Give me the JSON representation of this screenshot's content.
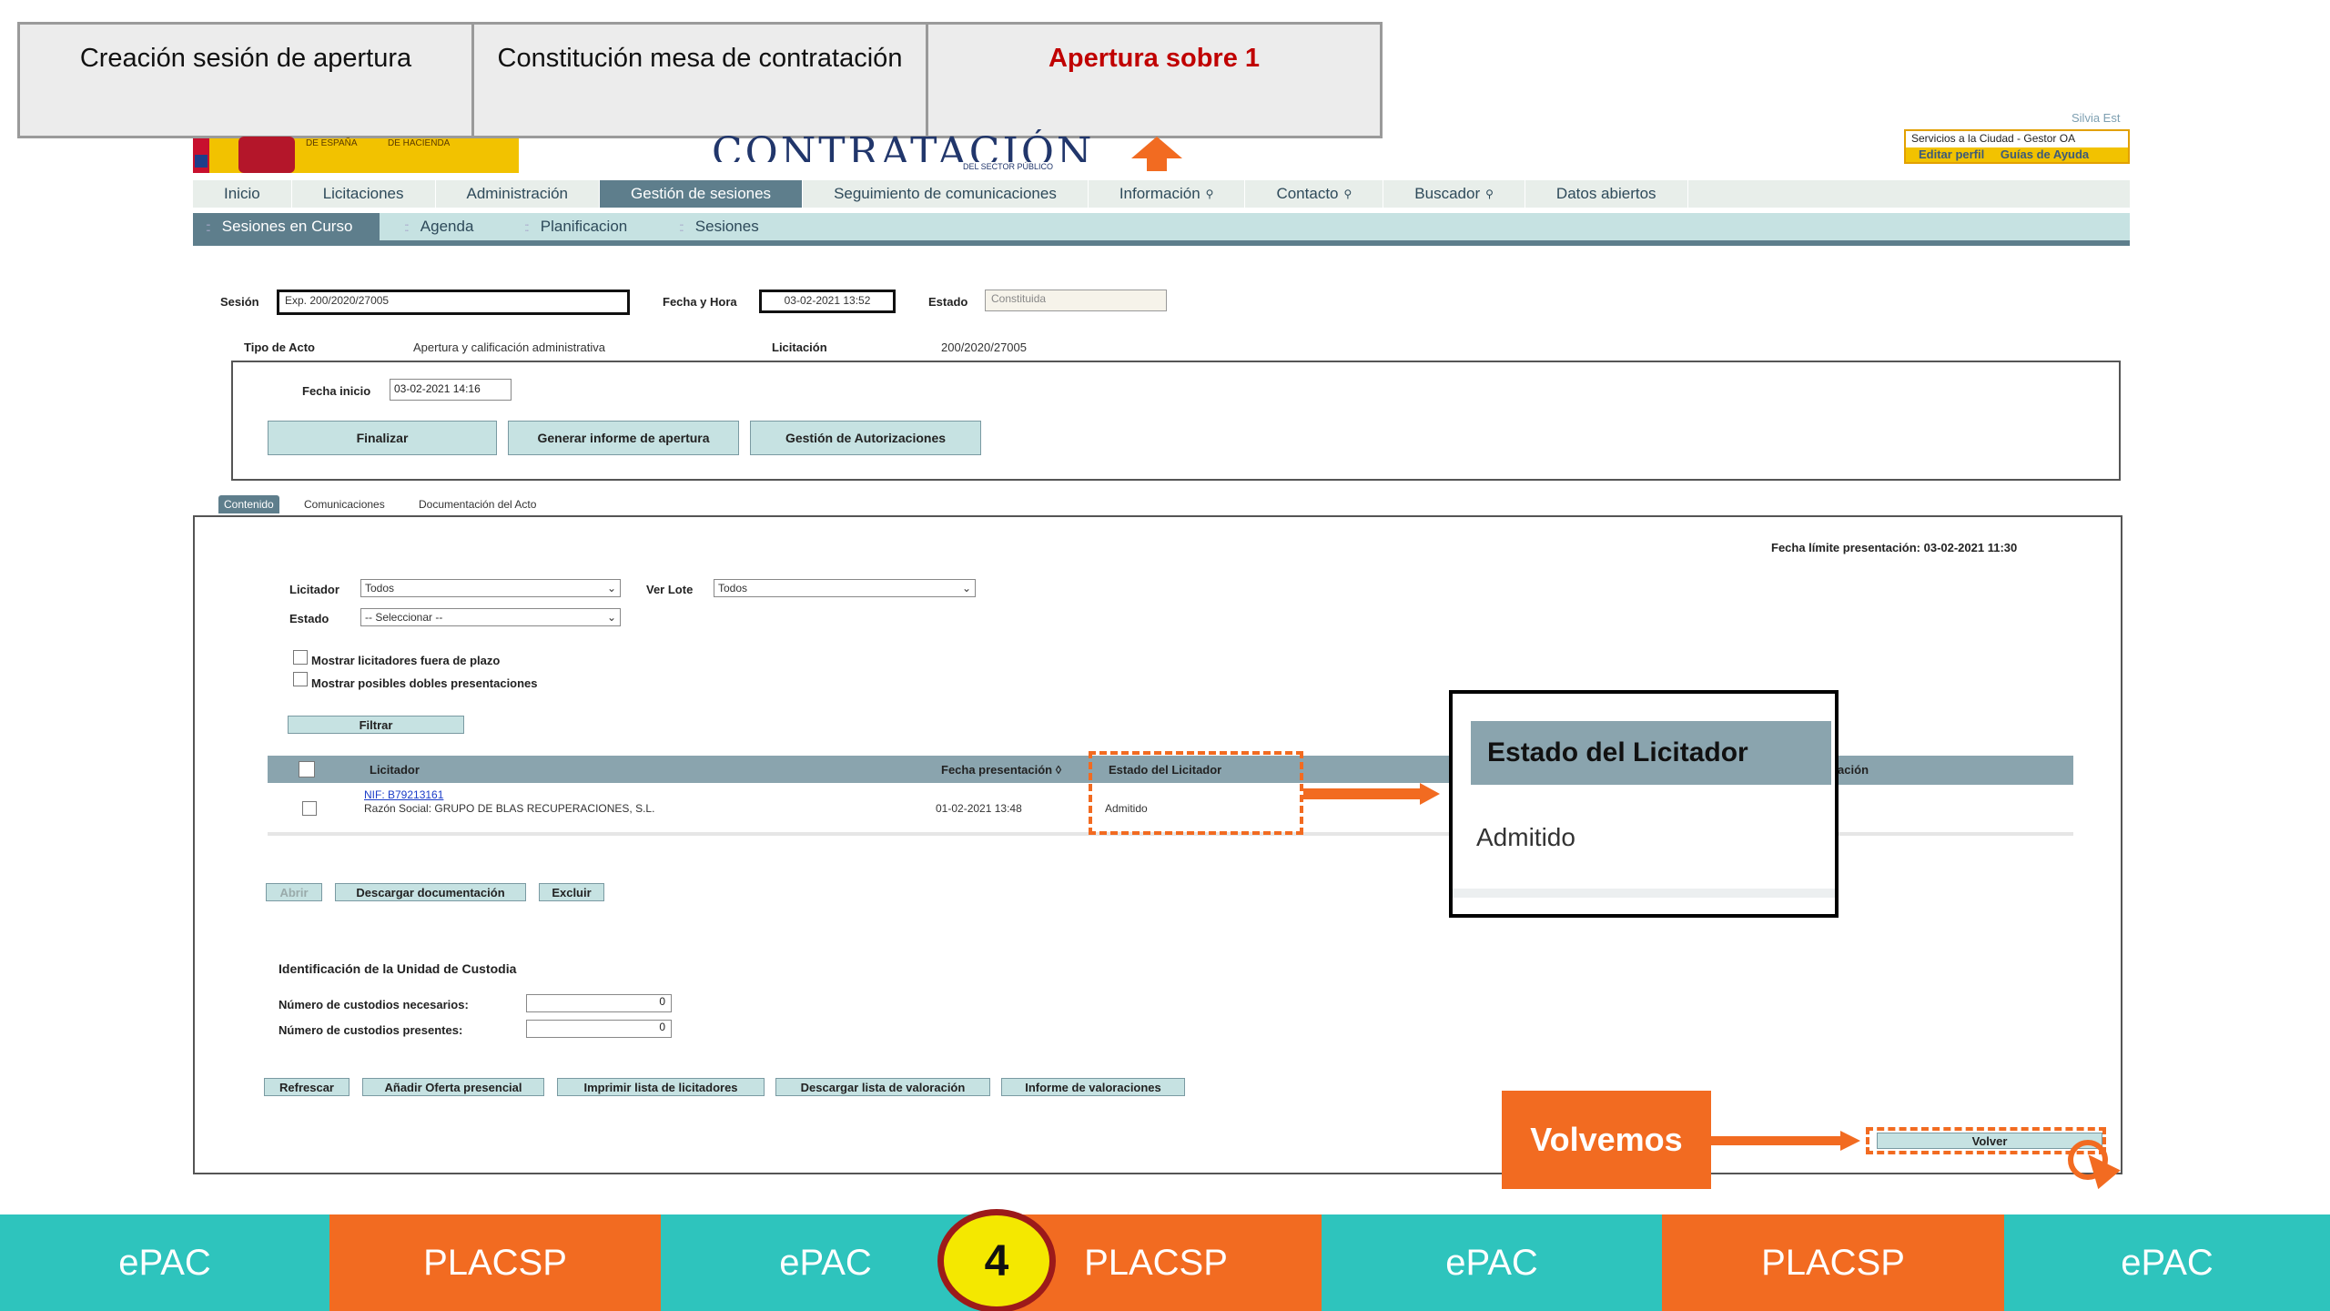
{
  "steps": [
    {
      "label": "Creación sesión de apertura"
    },
    {
      "label": "Constitución mesa de contratación"
    },
    {
      "label": "Apertura sobre 1"
    }
  ],
  "header": {
    "ministry_left": "DE ESPAÑA",
    "ministry_right": "DE HACIENDA",
    "logo": "CONTRATACIÓN",
    "logo_sub": "DEL SECTOR PÚBLICO",
    "user_name": "Silvia Est",
    "user_role": "Servicios a la Ciudad - Gestor OA",
    "edit_profile": "Editar perfil",
    "help": "Guías de Ayuda"
  },
  "nav": [
    {
      "label": "Inicio"
    },
    {
      "label": "Licitaciones"
    },
    {
      "label": "Administración"
    },
    {
      "label": "Gestión de sesiones"
    },
    {
      "label": "Seguimiento de comunicaciones"
    },
    {
      "label": "Información"
    },
    {
      "label": "Contacto"
    },
    {
      "label": "Buscador"
    },
    {
      "label": "Datos abiertos"
    }
  ],
  "subnav": [
    {
      "label": "Sesiones en Curso"
    },
    {
      "label": "Agenda"
    },
    {
      "label": "Planificacion"
    },
    {
      "label": "Sesiones"
    }
  ],
  "session": {
    "sesion_label": "Sesión",
    "sesion_value": "Exp. 200/2020/27005",
    "fecha_label": "Fecha y Hora",
    "fecha_value": "03-02-2021 13:52",
    "estado_label": "Estado",
    "estado_value": "Constituida",
    "tipo_label": "Tipo de Acto",
    "tipo_value": "Apertura y calificación administrativa",
    "licitacion_label": "Licitación",
    "licitacion_value": "200/2020/27005",
    "fecha_inicio_label": "Fecha inicio",
    "fecha_inicio_value": "03-02-2021 14:16"
  },
  "actions": {
    "finalizar": "Finalizar",
    "generar": "Generar informe de apertura",
    "gestion": "Gestión de Autorizaciones"
  },
  "tabs": {
    "contenido": "Contenido",
    "comunicaciones": "Comunicaciones",
    "documentacion": "Documentación del Acto"
  },
  "filters": {
    "fecha_limite": "Fecha límite presentación: 03-02-2021 11:30",
    "licitador_label": "Licitador",
    "licitador_value": "Todos",
    "ver_lote_label": "Ver Lote",
    "ver_lote_value": "Todos",
    "estado_label": "Estado",
    "estado_value": "-- Seleccionar --",
    "check1": "Mostrar licitadores fuera de plazo",
    "check2": "Mostrar posibles dobles presentaciones",
    "filtrar": "Filtrar"
  },
  "table": {
    "col_licitador": "Licitador",
    "col_fecha": "Fecha presentación",
    "col_estado": "Estado del Licitador",
    "col_valoracion": "ración",
    "rows": [
      {
        "nif": "NIF: B79213161",
        "razon": "Razón Social: GRUPO DE BLAS RECUPERACIONES, S.L.",
        "fecha": "01-02-2021 13:48",
        "estado": "Admitido"
      }
    ]
  },
  "row_actions": {
    "abrir": "Abrir",
    "descargar": "Descargar documentación",
    "excluir": "Excluir"
  },
  "custodia": {
    "title": "Identificación de la Unidad de Custodia",
    "necesarios_label": "Número de custodios necesarios:",
    "necesarios_value": "0",
    "presentes_label": "Número de custodios presentes:",
    "presentes_value": "0"
  },
  "bottom_actions": {
    "refrescar": "Refrescar",
    "anadir": "Añadir Oferta presencial",
    "imprimir": "Imprimir lista de licitadores",
    "descargar_lista": "Descargar lista de valoración",
    "informe": "Informe de valoraciones",
    "volver": "Volver"
  },
  "callouts": {
    "zoom_header": "Estado del Licitador",
    "zoom_value": "Admitido",
    "volvemos": "Volvemos"
  },
  "band": {
    "segments": [
      "ePAC",
      "PLACSP",
      "ePAC",
      "PLACSP",
      "ePAC",
      "PLACSP",
      "ePAC"
    ],
    "step_number": "4"
  },
  "colors": {
    "accent_orange": "#f26b21",
    "teal": "#2ec4bd",
    "active_step": "#c00000",
    "nav_active": "#5e7e8c"
  }
}
